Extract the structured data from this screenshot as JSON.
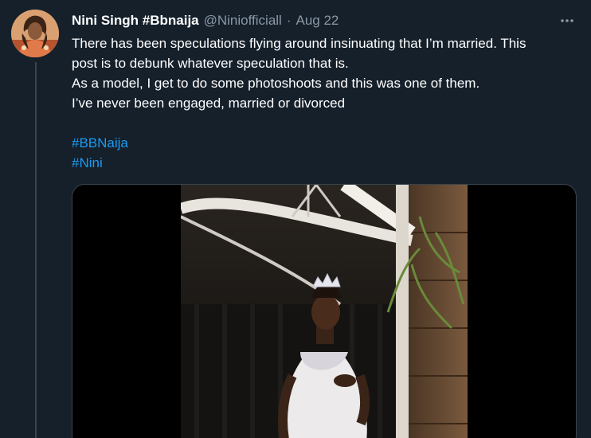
{
  "author": {
    "display_name": "Nini Singh #Bbnaija",
    "handle": "@Niniofficiall",
    "separator": "·",
    "date": "Aug 22"
  },
  "more_icon": "more-horizontal-icon",
  "tweet": {
    "lines": [
      "There has been speculations flying around insinuating that I’m married. This",
      "post is to debunk whatever speculation that is.",
      "As a model, I get to do some photoshoots and this was one of them.",
      "I’ve never been engaged, married or divorced"
    ],
    "hashtags": [
      "#BBNaija",
      "#Nini"
    ]
  },
  "colors": {
    "background": "#15202b",
    "text_primary": "#ffffff",
    "text_secondary": "#8b98a5",
    "link": "#1d9bf0",
    "border": "#38444d"
  },
  "media": {
    "type": "video"
  }
}
